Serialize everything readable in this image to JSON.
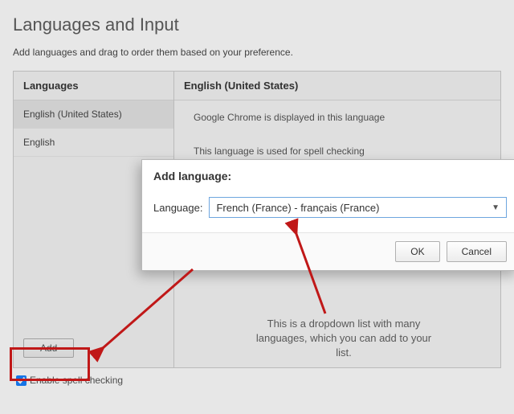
{
  "page": {
    "title": "Languages and Input",
    "description": "Add languages and drag to order them based on your preference."
  },
  "leftPanel": {
    "header": "Languages",
    "items": [
      {
        "label": "English (United States)",
        "selected": true
      },
      {
        "label": "English",
        "selected": false
      }
    ],
    "addButton": "Add"
  },
  "rightPanel": {
    "header": "English (United States)",
    "line1": "Google Chrome is displayed in this language",
    "line2": "This language is used for spell checking"
  },
  "enableSpell": {
    "label": "Enable spell checking",
    "checked": true
  },
  "modal": {
    "title": "Add language:",
    "fieldLabel": "Language:",
    "selected": "French (France) - français (France)",
    "ok": "OK",
    "cancel": "Cancel"
  },
  "annotation": {
    "text": "This is a dropdown list with many languages, which you can add to your list."
  },
  "colors": {
    "accentRed": "#c01818",
    "dropdownBorder": "#6ea6df"
  }
}
